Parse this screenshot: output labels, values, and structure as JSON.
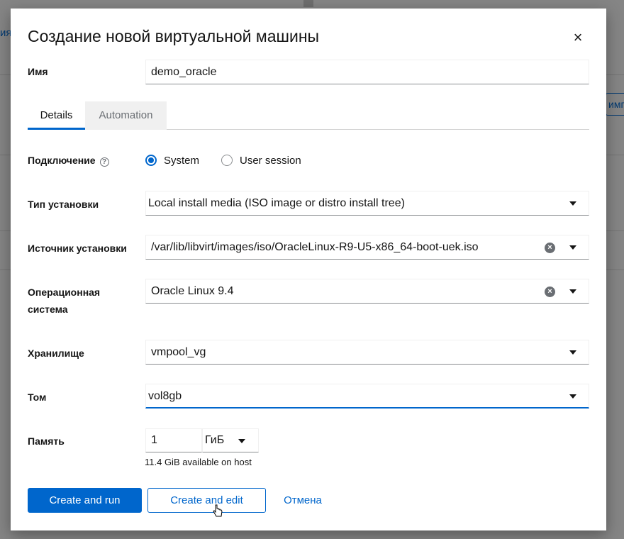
{
  "background": {
    "left_text": "ия",
    "right_button_text": "импо"
  },
  "dialog": {
    "title": "Создание новой виртуальной машины",
    "close_glyph": "×"
  },
  "name": {
    "label": "Имя",
    "value": "demo_oracle"
  },
  "tabs": [
    {
      "label": "Details",
      "selected": true
    },
    {
      "label": "Automation",
      "selected": false
    }
  ],
  "connection": {
    "label": "Подключение",
    "help_glyph": "?",
    "options": [
      {
        "label": "System",
        "checked": true
      },
      {
        "label": "User session",
        "checked": false
      }
    ]
  },
  "install_type": {
    "label": "Тип установки",
    "value": "Local install media (ISO image or distro install tree)"
  },
  "install_source": {
    "label": "Источник установки",
    "value": "/var/lib/libvirt/images/iso/OracleLinux-R9-U5-x86_64-boot-uek.iso"
  },
  "os": {
    "label_line1": "Операционная",
    "label_line2": "система",
    "value": "Oracle Linux 9.4"
  },
  "storage": {
    "label": "Хранилище",
    "value": "vmpool_vg"
  },
  "volume": {
    "label": "Том",
    "value": "vol8gb"
  },
  "memory": {
    "label": "Память",
    "value": "1",
    "unit": "ГиБ",
    "helper": "11.4 GiB available on host"
  },
  "buttons": {
    "create_run": "Create and run",
    "create_edit": "Create and edit",
    "cancel": "Отмена"
  },
  "colors": {
    "accent": "#0066cc",
    "backdrop": "#8a8a8a"
  }
}
